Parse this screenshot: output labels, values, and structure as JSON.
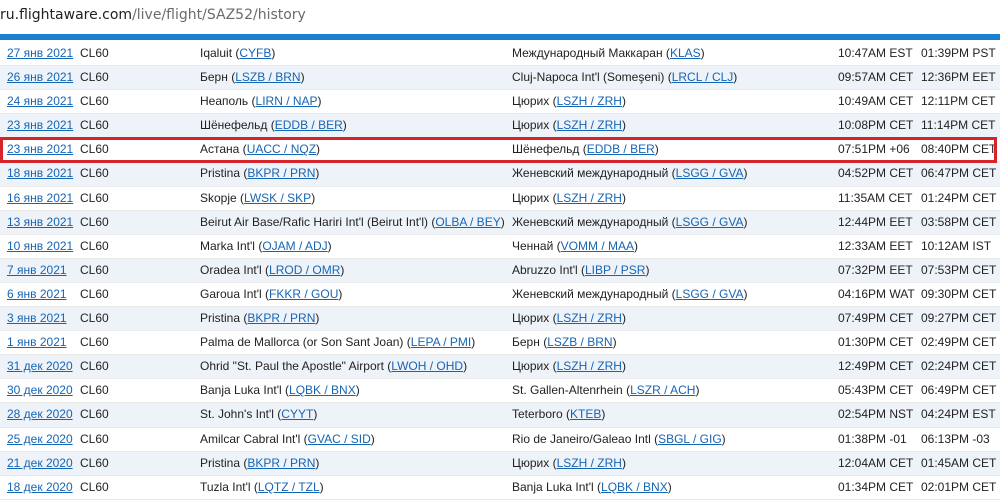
{
  "browser": {
    "url_host": "ru.flightaware.com",
    "url_path": "/live/flight/SAZ52/history"
  },
  "rows": [
    {
      "date": "27 янв 2021",
      "aircraft": "CL60",
      "origin_name": "Iqaluit",
      "origin_code": "CYFB",
      "dest_name": "Международный Маккаран",
      "dest_code": "KLAS",
      "dep": "10:47AM EST",
      "arr": "01:39PM PST"
    },
    {
      "date": "26 янв 2021",
      "aircraft": "CL60",
      "origin_name": "Берн",
      "origin_code": "LSZB / BRN",
      "dest_name": "Cluj-Napoca Int'l (Someşeni)",
      "dest_code": "LRCL / CLJ",
      "dep": "09:57AM CET",
      "arr": "12:36PM EET"
    },
    {
      "date": "24 янв 2021",
      "aircraft": "CL60",
      "origin_name": "Неаполь",
      "origin_code": "LIRN / NAP",
      "dest_name": "Цюрих",
      "dest_code": "LSZH / ZRH",
      "dep": "10:49AM CET",
      "arr": "12:11PM CET"
    },
    {
      "date": "23 янв 2021",
      "aircraft": "CL60",
      "origin_name": "Шёнефельд",
      "origin_code": "EDDB / BER",
      "dest_name": "Цюрих",
      "dest_code": "LSZH / ZRH",
      "dep": "10:08PM CET",
      "arr": "11:14PM CET"
    },
    {
      "date": "23 янв 2021",
      "aircraft": "CL60",
      "origin_name": "Астана",
      "origin_code": "UACC / NQZ",
      "dest_name": "Шёнефельд",
      "dest_code": "EDDB / BER",
      "dep": "07:51PM +06",
      "arr": "08:40PM CET"
    },
    {
      "date": "18 янв 2021",
      "aircraft": "CL60",
      "origin_name": "Pristina",
      "origin_code": "BKPR / PRN",
      "dest_name": "Женевский международный",
      "dest_code": "LSGG / GVA",
      "dep": "04:52PM CET",
      "arr": "06:47PM CET"
    },
    {
      "date": "16 янв 2021",
      "aircraft": "CL60",
      "origin_name": "Skopje",
      "origin_code": "LWSK / SKP",
      "dest_name": "Цюрих",
      "dest_code": "LSZH / ZRH",
      "dep": "11:35AM CET",
      "arr": "01:24PM CET"
    },
    {
      "date": "13 янв 2021",
      "aircraft": "CL60",
      "origin_name": "Beirut Air Base/Rafic Hariri Int'l (Beirut Int'l)",
      "origin_code": "OLBA / BEY",
      "dest_name": "Женевский международный",
      "dest_code": "LSGG / GVA",
      "dep": "12:44PM EET",
      "arr": "03:58PM CET"
    },
    {
      "date": "10 янв 2021",
      "aircraft": "CL60",
      "origin_name": "Marka Int'l",
      "origin_code": "OJAM / ADJ",
      "dest_name": "Ченнай",
      "dest_code": "VOMM / MAA",
      "dep": "12:33AM EET",
      "arr": "10:12AM IST"
    },
    {
      "date": "7 янв 2021",
      "aircraft": "CL60",
      "origin_name": "Oradea Int'l",
      "origin_code": "LROD / OMR",
      "dest_name": "Abruzzo Int'l",
      "dest_code": "LIBP / PSR",
      "dep": "07:32PM EET",
      "arr": "07:53PM CET"
    },
    {
      "date": "6 янв 2021",
      "aircraft": "CL60",
      "origin_name": "Garoua Int'l",
      "origin_code": "FKKR / GOU",
      "dest_name": "Женевский международный",
      "dest_code": "LSGG / GVA",
      "dep": "04:16PM WAT",
      "arr": "09:30PM CET"
    },
    {
      "date": "3 янв 2021",
      "aircraft": "CL60",
      "origin_name": "Pristina",
      "origin_code": "BKPR / PRN",
      "dest_name": "Цюрих",
      "dest_code": "LSZH / ZRH",
      "dep": "07:49PM CET",
      "arr": "09:27PM CET"
    },
    {
      "date": "1 янв 2021",
      "aircraft": "CL60",
      "origin_name": "Palma de Mallorca (or Son Sant Joan)",
      "origin_code": "LEPA / PMI",
      "dest_name": "Берн",
      "dest_code": "LSZB / BRN",
      "dep": "01:30PM CET",
      "arr": "02:49PM CET"
    },
    {
      "date": "31 дек 2020",
      "aircraft": "CL60",
      "origin_name": "Ohrid \"St. Paul the Apostle\" Airport",
      "origin_code": "LWOH / OHD",
      "dest_name": "Цюрих",
      "dest_code": "LSZH / ZRH",
      "dep": "12:49PM CET",
      "arr": "02:24PM CET"
    },
    {
      "date": "30 дек 2020",
      "aircraft": "CL60",
      "origin_name": "Banja Luka Int'l",
      "origin_code": "LQBK / BNX",
      "dest_name": "St. Gallen-Altenrhein",
      "dest_code": "LSZR / ACH",
      "dep": "05:43PM CET",
      "arr": "06:49PM CET"
    },
    {
      "date": "28 дек 2020",
      "aircraft": "CL60",
      "origin_name": "St. John's Int'l",
      "origin_code": "CYYT",
      "dest_name": "Teterboro",
      "dest_code": "KTEB",
      "dep": "02:54PM NST",
      "arr": "04:24PM EST"
    },
    {
      "date": "25 дек 2020",
      "aircraft": "CL60",
      "origin_name": "Amilcar Cabral Int'l",
      "origin_code": "GVAC / SID",
      "dest_name": "Rio de Janeiro/Galeao Intl",
      "dest_code": "SBGL / GIG",
      "dep": "01:38PM -01",
      "arr": "06:13PM -03"
    },
    {
      "date": "21 дек 2020",
      "aircraft": "CL60",
      "origin_name": "Pristina",
      "origin_code": "BKPR / PRN",
      "dest_name": "Цюрих",
      "dest_code": "LSZH / ZRH",
      "dep": "12:04AM CET",
      "arr": "01:45AM CET"
    },
    {
      "date": "18 дек 2020",
      "aircraft": "CL60",
      "origin_name": "Tuzla Int'l",
      "origin_code": "LQTZ / TZL",
      "dest_name": "Banja Luka Int'l",
      "dest_code": "LQBK / BNX",
      "dep": "01:34PM CET",
      "arr": "02:01PM CET"
    }
  ],
  "highlighted_row": 4,
  "colors": {
    "accent_bar": "#1a7fcf",
    "link": "#1565b5",
    "highlight_border": "#d6242b",
    "row_alt": "#eef3f9"
  }
}
